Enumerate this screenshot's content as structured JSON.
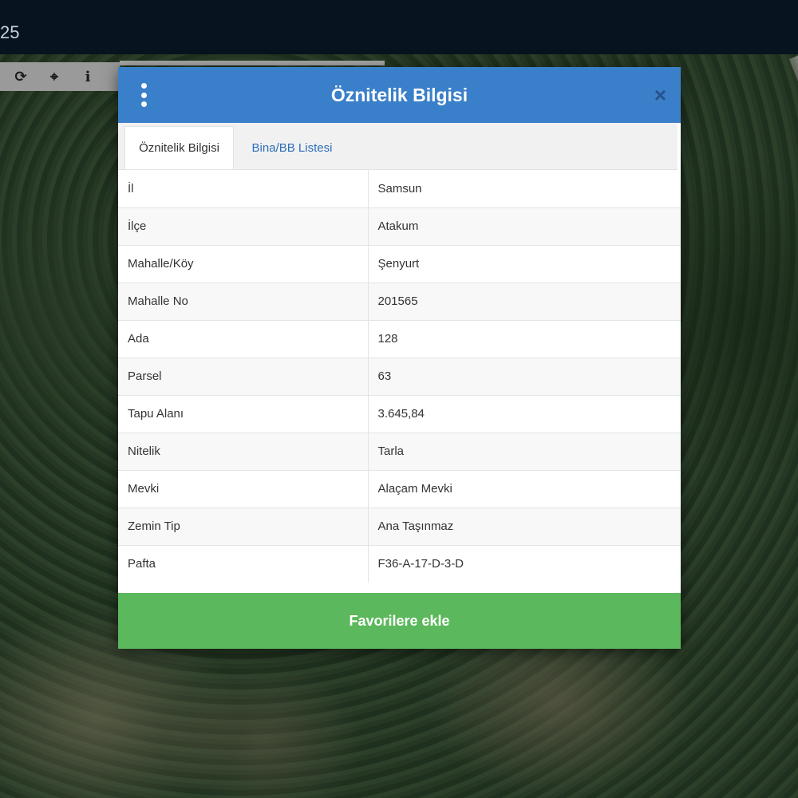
{
  "topbar": {
    "text": "25"
  },
  "toolbar": {
    "icons": [
      "refresh-icon",
      "crosshair-icon",
      "info-icon"
    ],
    "glyphs": [
      "⟳",
      "⌖",
      "i"
    ]
  },
  "modal": {
    "title": "Öznitelik Bilgisi",
    "close_glyph": "×",
    "tabs": [
      {
        "label": "Öznitelik Bilgisi",
        "active": true
      },
      {
        "label": "Bina/BB Listesi",
        "active": false
      }
    ],
    "rows": [
      {
        "key": "İl",
        "value": "Samsun"
      },
      {
        "key": "İlçe",
        "value": "Atakum"
      },
      {
        "key": "Mahalle/Köy",
        "value": "Şenyurt"
      },
      {
        "key": "Mahalle No",
        "value": "201565"
      },
      {
        "key": "Ada",
        "value": "128"
      },
      {
        "key": "Parsel",
        "value": "63"
      },
      {
        "key": "Tapu Alanı",
        "value": "3.645,84"
      },
      {
        "key": "Nitelik",
        "value": "Tarla"
      },
      {
        "key": "Mevki",
        "value": "Alaçam Mevki"
      },
      {
        "key": "Zemin Tip",
        "value": "Ana Taşınmaz"
      },
      {
        "key": "Pafta",
        "value": "F36-A-17-D-3-D"
      }
    ],
    "favorite_button": "Favorilere ekle"
  },
  "colors": {
    "header_blue": "#3a7fc9",
    "button_green": "#5cb85c",
    "topbar": "#07131f"
  }
}
